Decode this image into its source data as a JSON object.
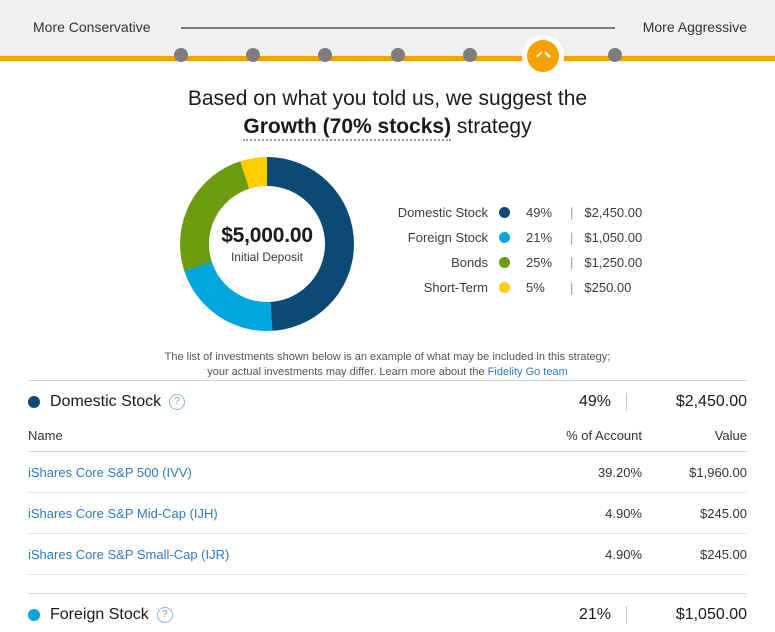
{
  "risk_slider": {
    "left_label": "More Conservative",
    "right_label": "More Aggressive",
    "steps": 7,
    "selected_index": 6,
    "knob_icon": "left-right-arrows-icon",
    "accent_color": "#f5a200"
  },
  "headline": {
    "line1": "Based on what you told us, we suggest the",
    "strategy": "Growth (70% stocks)",
    "line2_suffix": " strategy"
  },
  "donut": {
    "center_amount": "$5,000.00",
    "center_caption": "Initial Deposit"
  },
  "chart_data": {
    "type": "pie",
    "title": "Growth (70% stocks) strategy allocation",
    "total_label": "$5,000.00",
    "total_caption": "Initial Deposit",
    "categories": [
      "Domestic Stock",
      "Foreign Stock",
      "Bonds",
      "Short-Term"
    ],
    "values": [
      49,
      21,
      25,
      5
    ],
    "value_labels": [
      "49%",
      "21%",
      "25%",
      "5%"
    ],
    "amounts": [
      "$2,450.00",
      "$1,050.00",
      "$1,250.00",
      "$250.00"
    ],
    "colors": [
      "#0d4a73",
      "#00a6dd",
      "#6d9c11",
      "#ffcd00"
    ],
    "legend_position": "right",
    "legend_separator": "|"
  },
  "legend": [
    {
      "name": "Domestic Stock",
      "color": "#0d4a73",
      "pct": "49%",
      "sep": "|",
      "value": "$2,450.00"
    },
    {
      "name": "Foreign Stock",
      "color": "#00a6dd",
      "pct": "21%",
      "sep": "|",
      "value": "$1,050.00"
    },
    {
      "name": "Bonds",
      "color": "#6d9c11",
      "pct": "25%",
      "sep": "|",
      "value": "$1,250.00"
    },
    {
      "name": "Short-Term",
      "color": "#ffcd00",
      "pct": "5%",
      "sep": "|",
      "value": "$250.00"
    }
  ],
  "disclaimer": {
    "line1": "The list of investments shown below is an example of what may be included in this strategy;",
    "line2_prefix": "your actual investments may differ. Learn more about the ",
    "link_text": "Fidelity Go team"
  },
  "table_headers": {
    "name": "Name",
    "pct": "% of Account",
    "value": "Value"
  },
  "sections": [
    {
      "title": "Domestic Stock",
      "color": "#0d4a73",
      "pct": "49%",
      "value": "$2,450.00",
      "help_icon": "question-mark-icon",
      "holdings": [
        {
          "name": "iShares Core S&P 500 (IVV)",
          "pct": "39.20%",
          "value": "$1,960.00"
        },
        {
          "name": "iShares Core S&P Mid-Cap (IJH)",
          "pct": "4.90%",
          "value": "$245.00"
        },
        {
          "name": "iShares Core S&P Small-Cap (IJR)",
          "pct": "4.90%",
          "value": "$245.00"
        }
      ]
    },
    {
      "title": "Foreign Stock",
      "color": "#00a6dd",
      "pct": "21%",
      "value": "$1,050.00",
      "help_icon": "question-mark-icon",
      "holdings": []
    }
  ]
}
